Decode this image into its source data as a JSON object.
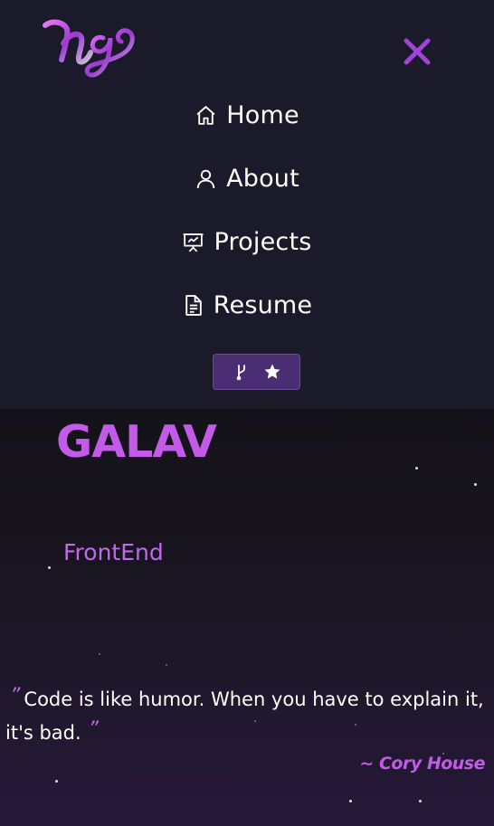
{
  "nav": {
    "logo_icon": "ng-signature-logo",
    "close_icon": "close-icon",
    "items": [
      {
        "label": "Home",
        "icon": "home-icon"
      },
      {
        "label": "About",
        "icon": "user-icon"
      },
      {
        "label": "Projects",
        "icon": "presentation-icon"
      },
      {
        "label": "Resume",
        "icon": "document-icon"
      }
    ],
    "github_button": {
      "icons": [
        "git-fork-icon",
        "star-icon"
      ]
    }
  },
  "hero": {
    "name": "GALAV",
    "role": "FrontEnd",
    "quote": "Code is like humor. When you have to explain it, it's bad.",
    "quote_open": "”",
    "quote_close": "”",
    "author": "~ Cory House"
  },
  "colors": {
    "nav_bg": "#1b1a2a",
    "accent": "#c45ae8",
    "button_bg": "#4a2d72",
    "text": "#ffffff"
  }
}
